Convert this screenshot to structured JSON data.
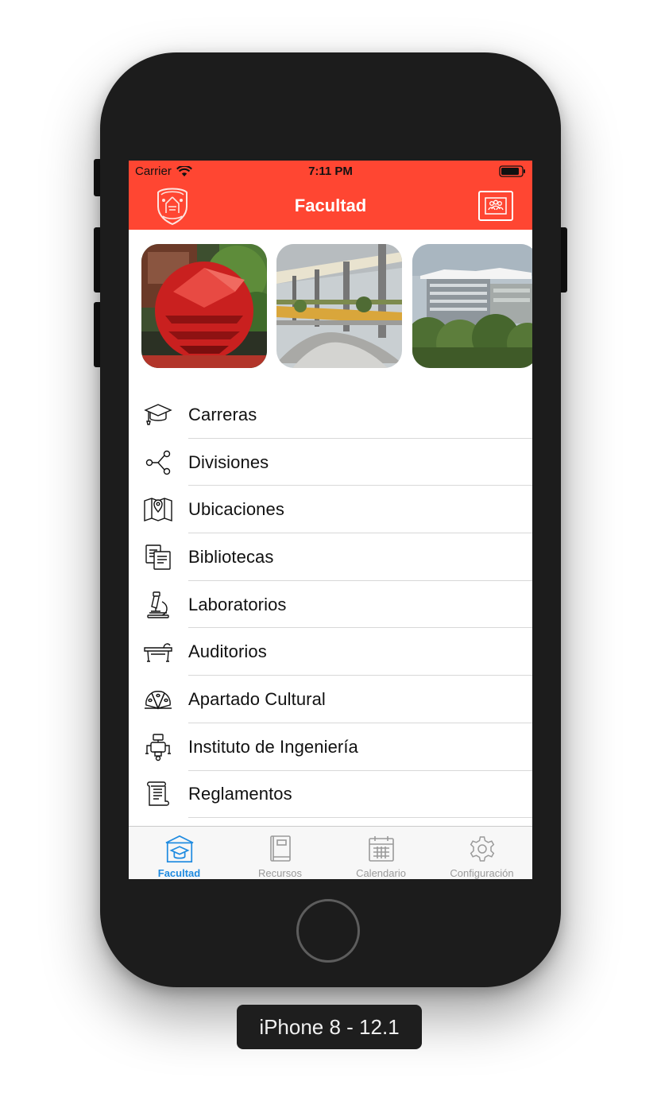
{
  "device": {
    "label": "iPhone 8 - 12.1"
  },
  "status_bar": {
    "carrier": "Carrier",
    "time": "7:11 PM"
  },
  "nav_bar": {
    "title": "Facultad",
    "logo_icon": "unam-engineering-crest",
    "action_icon": "classroom-icon"
  },
  "gallery": [
    {
      "name": "red-sculpture-photo"
    },
    {
      "name": "bridge-walkway-photo"
    },
    {
      "name": "campus-building-photo"
    }
  ],
  "menu": {
    "items": [
      {
        "label": "Carreras",
        "icon": "graduation-cap-icon"
      },
      {
        "label": "Divisiones",
        "icon": "network-icon"
      },
      {
        "label": "Ubicaciones",
        "icon": "map-pin-icon"
      },
      {
        "label": "Bibliotecas",
        "icon": "books-icon"
      },
      {
        "label": "Laboratorios",
        "icon": "microscope-icon"
      },
      {
        "label": "Auditorios",
        "icon": "lectern-icon"
      },
      {
        "label": "Apartado Cultural",
        "icon": "peacock-fan-icon"
      },
      {
        "label": "Instituto de Ingeniería",
        "icon": "robot-icon"
      },
      {
        "label": "Reglamentos",
        "icon": "scroll-icon"
      }
    ]
  },
  "tab_bar": {
    "tabs": [
      {
        "label": "Facultad",
        "icon": "school-icon",
        "active": true
      },
      {
        "label": "Recursos",
        "icon": "book-icon",
        "active": false
      },
      {
        "label": "Calendario",
        "icon": "calendar-icon",
        "active": false
      },
      {
        "label": "Configuración",
        "icon": "gear-icon",
        "active": false
      }
    ]
  },
  "colors": {
    "accent": "#ff4632",
    "tab_active": "#1f8be0",
    "tab_inactive": "#9a9a9a"
  }
}
